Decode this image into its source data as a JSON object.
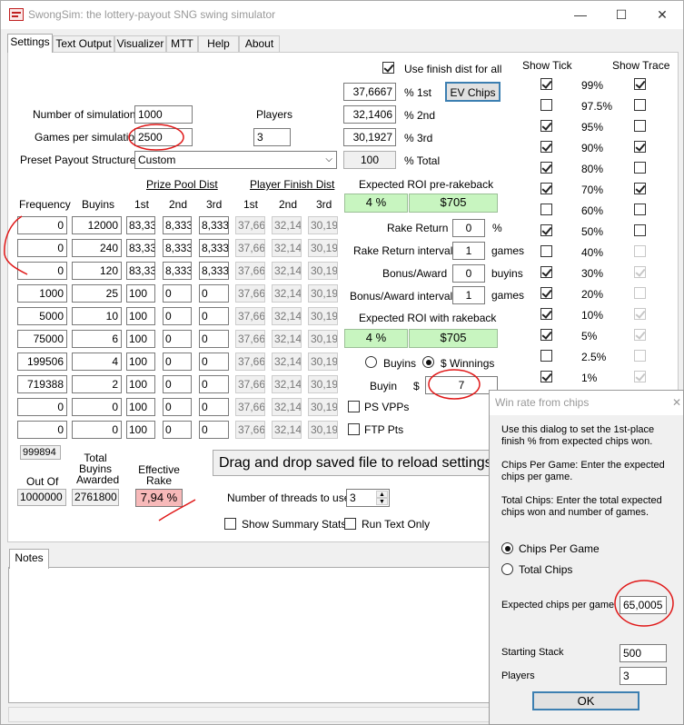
{
  "window": {
    "title": "SwongSim: the lottery-payout SNG swing simulator",
    "minimize": "—",
    "maximize": "☐",
    "close": "✕"
  },
  "tabs": [
    "Settings",
    "Text Output",
    "Visualizer",
    "MTT",
    "Help",
    "About"
  ],
  "settings": {
    "num_sims_label": "Number of simulations",
    "num_sims": "1000",
    "games_label": "Games per simulation",
    "games": "2500",
    "players_label": "Players",
    "players": "3",
    "preset_label": "Preset Payout Structures",
    "preset": "Custom",
    "use_finish_label": "Use finish dist for all",
    "ev_chips": "EV Chips",
    "pct_1st": "37,6667",
    "pct_1st_label": "% 1st",
    "pct_2nd": "32,1406",
    "pct_2nd_label": "% 2nd",
    "pct_3rd": "30,1927",
    "pct_3rd_label": "% 3rd",
    "pct_total": "100",
    "pct_total_label": "% Total"
  },
  "table": {
    "prize_pool_header": "Prize Pool Dist",
    "player_finish_header": "Player Finish Dist",
    "col_frequency": "Frequency",
    "col_buyins": "Buyins",
    "col_1st": "1st",
    "col_2nd": "2nd",
    "col_3rd": "3rd",
    "rows": [
      {
        "freq": "0",
        "buyins": "12000",
        "p1": "83,33",
        "p2": "8,333",
        "p3": "8,333",
        "f1": "37,66",
        "f2": "32,14",
        "f3": "30,19"
      },
      {
        "freq": "0",
        "buyins": "240",
        "p1": "83,33",
        "p2": "8,333",
        "p3": "8,333",
        "f1": "37,66",
        "f2": "32,14",
        "f3": "30,19"
      },
      {
        "freq": "0",
        "buyins": "120",
        "p1": "83,33",
        "p2": "8,333",
        "p3": "8,333",
        "f1": "37,66",
        "f2": "32,14",
        "f3": "30,19"
      },
      {
        "freq": "1000",
        "buyins": "25",
        "p1": "100",
        "p2": "0",
        "p3": "0",
        "f1": "37,66",
        "f2": "32,14",
        "f3": "30,19"
      },
      {
        "freq": "5000",
        "buyins": "10",
        "p1": "100",
        "p2": "0",
        "p3": "0",
        "f1": "37,66",
        "f2": "32,14",
        "f3": "30,19"
      },
      {
        "freq": "75000",
        "buyins": "6",
        "p1": "100",
        "p2": "0",
        "p3": "0",
        "f1": "37,66",
        "f2": "32,14",
        "f3": "30,19"
      },
      {
        "freq": "199506",
        "buyins": "4",
        "p1": "100",
        "p2": "0",
        "p3": "0",
        "f1": "37,66",
        "f2": "32,14",
        "f3": "30,19"
      },
      {
        "freq": "719388",
        "buyins": "2",
        "p1": "100",
        "p2": "0",
        "p3": "0",
        "f1": "37,66",
        "f2": "32,14",
        "f3": "30,19"
      },
      {
        "freq": "0",
        "buyins": "0",
        "p1": "100",
        "p2": "0",
        "p3": "0",
        "f1": "37,66",
        "f2": "32,14",
        "f3": "30,19"
      },
      {
        "freq": "0",
        "buyins": "0",
        "p1": "100",
        "p2": "0",
        "p3": "0",
        "f1": "37,66",
        "f2": "32,14",
        "f3": "30,19"
      }
    ],
    "freq_sum": "999894",
    "out_of_label": "Out Of",
    "out_of": "1000000",
    "total_buyins_label": "Total\nBuyins\nAwarded",
    "total_buyins": "2761800",
    "eff_rake_label": "Effective\nRake",
    "eff_rake": "7,94 %"
  },
  "roi": {
    "pre_label": "Expected ROI pre-rakeback",
    "pre_pct": "4 %",
    "pre_amt": "$705",
    "rake_return_label": "Rake Return",
    "rake_return": "0",
    "rake_return_unit": "%",
    "rake_interval_label": "Rake Return interval",
    "rake_interval": "1",
    "rake_interval_unit": "games",
    "bonus_label": "Bonus/Award",
    "bonus": "0",
    "bonus_unit": "buyins",
    "bonus_interval_label": "Bonus/Award interval",
    "bonus_interval": "1",
    "bonus_interval_unit": "games",
    "with_label": "Expected ROI with rakeback",
    "with_pct": "4 %",
    "with_amt": "$705",
    "buyins_radio": "Buyins",
    "winnings_radio": "$ Winnings",
    "buyin_label": "Buyin",
    "buyin_currency": "$",
    "buyin": "7",
    "ps_vpps": "PS VPPs",
    "ftp_pts": "FTP Pts"
  },
  "drag_drop": "Drag and drop saved file to reload settings",
  "threads_label": "Number of threads to use",
  "threads": "3",
  "show_summary": "Show Summary Stats",
  "run_text": "Run Text Only",
  "notes_tab": "Notes",
  "ticks": {
    "show_tick_label": "Show Tick",
    "show_trace_label": "Show Trace",
    "rows": [
      {
        "pct": "99%",
        "tick": true,
        "trace": true,
        "trace_enabled": true
      },
      {
        "pct": "97.5%",
        "tick": false,
        "trace": false,
        "trace_enabled": true
      },
      {
        "pct": "95%",
        "tick": true,
        "trace": false,
        "trace_enabled": true
      },
      {
        "pct": "90%",
        "tick": true,
        "trace": true,
        "trace_enabled": true
      },
      {
        "pct": "80%",
        "tick": true,
        "trace": false,
        "trace_enabled": true
      },
      {
        "pct": "70%",
        "tick": true,
        "trace": true,
        "trace_enabled": true
      },
      {
        "pct": "60%",
        "tick": false,
        "trace": false,
        "trace_enabled": true
      },
      {
        "pct": "50%",
        "tick": true,
        "trace": false,
        "trace_enabled": true
      },
      {
        "pct": "40%",
        "tick": false,
        "trace": false,
        "trace_enabled": false
      },
      {
        "pct": "30%",
        "tick": true,
        "trace": true,
        "trace_enabled": false
      },
      {
        "pct": "20%",
        "tick": true,
        "trace": false,
        "trace_enabled": false
      },
      {
        "pct": "10%",
        "tick": true,
        "trace": true,
        "trace_enabled": false
      },
      {
        "pct": "5%",
        "tick": true,
        "trace": true,
        "trace_enabled": false
      },
      {
        "pct": "2.5%",
        "tick": false,
        "trace": false,
        "trace_enabled": false
      },
      {
        "pct": "1%",
        "tick": true,
        "trace": true,
        "trace_enabled": false
      }
    ]
  },
  "dialog": {
    "title": "Win rate from chips",
    "intro": "Use this dialog to set the 1st-place finish % from expected chips won.",
    "chips_per_game_help": "Chips Per Game:  Enter the expected chips per game.",
    "total_chips_help": "Total Chips:  Enter the total expected chips won and number of games.",
    "radio_cpg": "Chips Per Game",
    "radio_total": "Total Chips",
    "expected_label": "Expected chips per game",
    "expected": "65,0005",
    "stack_label": "Starting Stack",
    "stack": "500",
    "players_label": "Players",
    "players": "3",
    "ok": "OK"
  },
  "colors": {
    "annotation": "#e01818",
    "roi_green": "#c8f5c0",
    "rake_pink": "#f7b9b9",
    "ev_button_border": "#3c7fb1"
  }
}
